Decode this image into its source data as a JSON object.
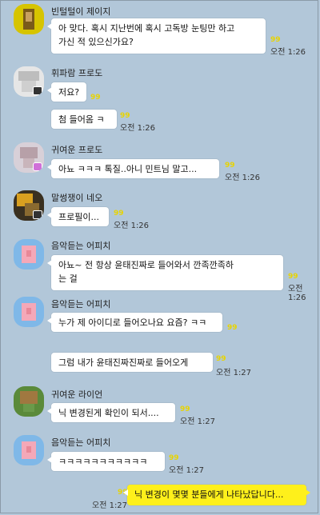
{
  "unread_mark": "99",
  "messages": [
    {
      "sender": "빈털털이 제이지",
      "lines": [
        "아 맞다. 혹시 지난번에 혹시 고독방 눈팅만 하고",
        "가신 적 있으신가요?"
      ],
      "time": "오전 1:26"
    },
    {
      "sender": "휘파람 프로도",
      "lines": [
        "저요?"
      ]
    },
    {
      "lines": [
        "첨 들어옴 ㅋ"
      ],
      "time": "오전 1:26"
    },
    {
      "sender": "귀여운 프로도",
      "lines": [
        "아뇨 ㅋㅋㅋ 톡질..아니 민트님 말고..."
      ],
      "time": "오전 1:26"
    },
    {
      "sender": "말썽쟁이 네오",
      "lines": [
        "프로필이..."
      ],
      "time": "오전 1:26"
    },
    {
      "sender": "음악듣는 어피치",
      "lines": [
        "아뇨~ 전 항상 윤태진짜로 들어와서  깐족깐족하",
        "는 걸"
      ],
      "time": "오전 1:26"
    },
    {
      "sender": "음악듣는 어피치",
      "lines": [
        "누가 제 아이디로 들어오나요 요즘? ㅋㅋ"
      ]
    },
    {
      "lines": [
        "그럼 내가 윤태진짜진짜로 들어오게"
      ],
      "time": "오전 1:27"
    },
    {
      "sender": "귀여운 라이언",
      "lines": [
        "닉 변경된게 확인이 되서...."
      ],
      "time": "오전 1:27"
    },
    {
      "sender": "음악듣는 어피치",
      "lines": [
        "ㅋㅋㅋㅋㅋㅋㅋㅋㅋㅋㅋ"
      ],
      "time": "오전 1:27"
    },
    {
      "lines": [
        "닉 변경이 몇몇 분들에게 나타났답니다..."
      ],
      "time": "오전 1:27",
      "mine": true
    }
  ],
  "colors": {
    "background": "#b2c7d9",
    "my_bubble": "#fef01b",
    "other_bubble": "#ffffff",
    "unread": "#e8d400"
  }
}
